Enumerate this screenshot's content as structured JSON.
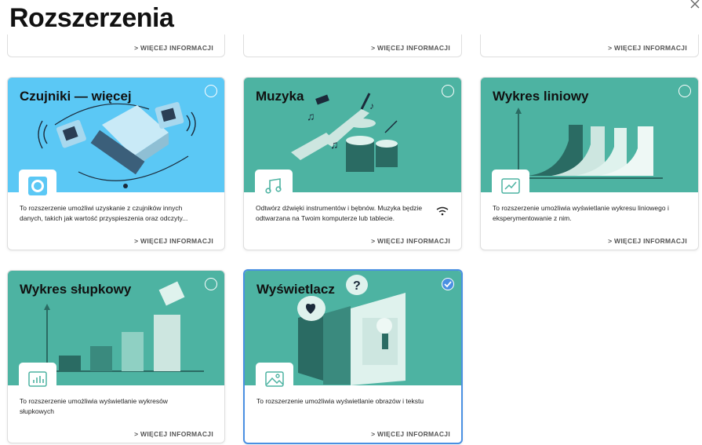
{
  "page": {
    "title": "Rozszerzenia"
  },
  "more_label": "> WIĘCEJ INFORMACJI",
  "colors": {
    "blue_banner": "#5bc8f5",
    "teal_banner": "#4db3a2",
    "selected_border": "#4a90e2"
  },
  "cards": [
    {
      "title": "Czujniki — więcej",
      "description": "To rozszerzenie umożliwi uzyskanie z czujników innych danych, takich jak wartość przyspieszenia oraz odczyty...",
      "icon": "sensor-icon",
      "selected": false
    },
    {
      "title": "Muzyka",
      "description": "Odtwórz dźwięki instrumentów i bębnów. Muzyka będzie odtwarzana na Twoim komputerze lub tablecie.",
      "icon": "music-note-icon",
      "selected": false,
      "extra_icon": "wifi-icon"
    },
    {
      "title": "Wykres liniowy",
      "description": "To rozszerzenie umożliwia wyświetlanie wykresu liniowego i eksperymentowanie z nim.",
      "icon": "line-chart-icon",
      "selected": false
    },
    {
      "title": "Wykres słupkowy",
      "description": "To rozszerzenie umożliwia wyświetlanie wykresów słupkowych",
      "icon": "bar-chart-icon",
      "selected": false
    },
    {
      "title": "Wyświetlacz",
      "description": "To rozszerzenie umożliwia wyświetlanie obrazów i tekstu",
      "icon": "image-icon",
      "selected": true
    }
  ]
}
